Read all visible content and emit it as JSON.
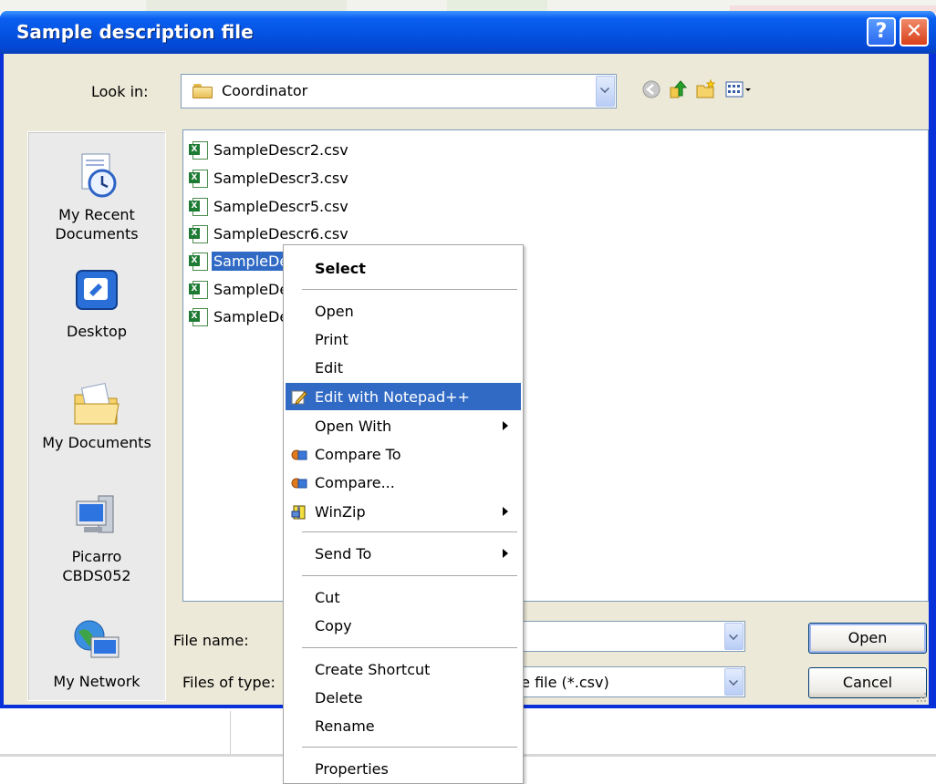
{
  "dialog": {
    "title": "Sample description file",
    "help_glyph": "?",
    "close_glyph": "✕"
  },
  "lookin": {
    "label": "Look in:",
    "value": "Coordinator"
  },
  "places": [
    {
      "line1": "My Recent",
      "line2": "Documents",
      "icon": "recent-documents-icon"
    },
    {
      "line1": "Desktop",
      "line2": "",
      "icon": "desktop-icon"
    },
    {
      "line1": "My Documents",
      "line2": "",
      "icon": "my-documents-icon"
    },
    {
      "line1": "Picarro",
      "line2": "CBDS052",
      "icon": "computer-icon"
    },
    {
      "line1": "My Network",
      "line2": "",
      "icon": "network-icon"
    }
  ],
  "files": [
    {
      "name": "SampleDescr2.csv"
    },
    {
      "name": "SampleDescr3.csv"
    },
    {
      "name": "SampleDescr5.csv"
    },
    {
      "name": "SampleDescr6.csv"
    },
    {
      "name": "SampleDe"
    },
    {
      "name": "SampleDe"
    },
    {
      "name": "SampleDe"
    }
  ],
  "filename": {
    "label": "File name:",
    "value": ""
  },
  "filetype": {
    "label": "Files of type:",
    "value": "ne file (*.csv)"
  },
  "buttons": {
    "open": "Open",
    "cancel": "Cancel"
  },
  "context_menu": {
    "items": [
      {
        "label": "Select"
      },
      {
        "label": "Open"
      },
      {
        "label": "Print"
      },
      {
        "label": "Edit"
      },
      {
        "label": "Edit with Notepad++"
      },
      {
        "label": "Open With"
      },
      {
        "label": "Compare To"
      },
      {
        "label": "Compare..."
      },
      {
        "label": "WinZip"
      },
      {
        "label": "Send To"
      },
      {
        "label": "Cut"
      },
      {
        "label": "Copy"
      },
      {
        "label": "Create Shortcut"
      },
      {
        "label": "Delete"
      },
      {
        "label": "Rename"
      },
      {
        "label": "Properties"
      }
    ]
  },
  "colors": {
    "title_blue": "#0554e3",
    "dialog_face": "#ece9d8",
    "selection": "#316ac5"
  }
}
